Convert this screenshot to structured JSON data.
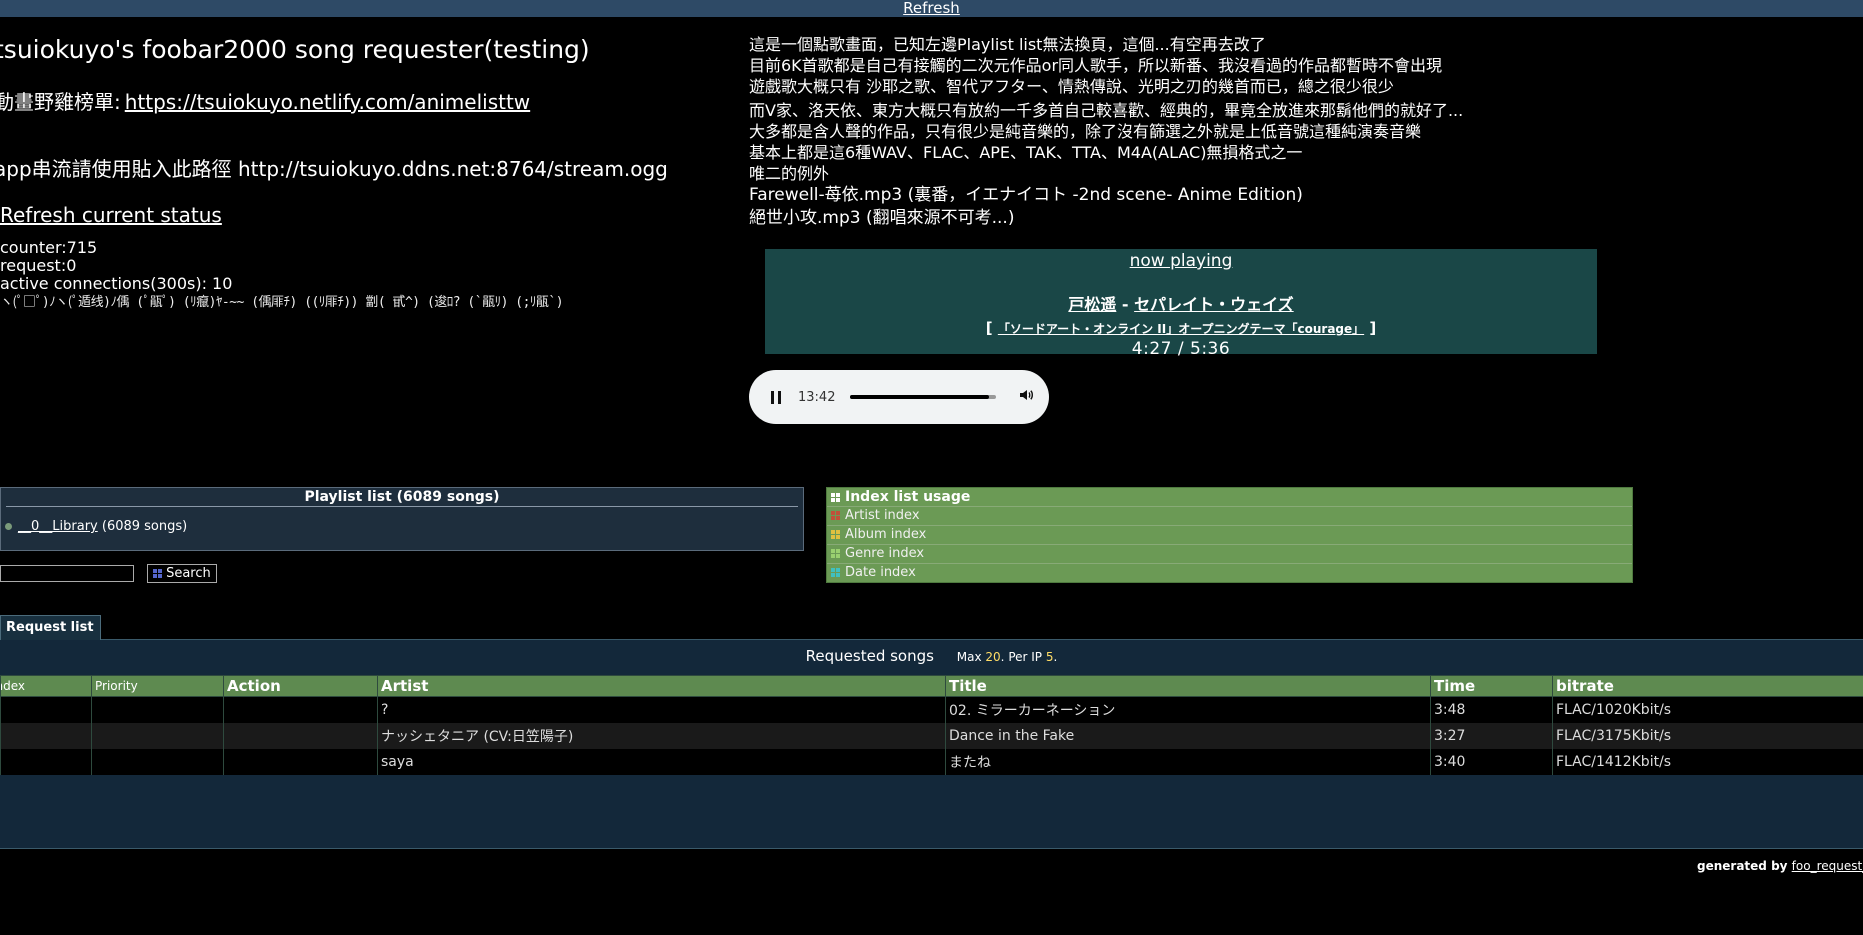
{
  "topbar": {
    "refresh_label": "Refresh"
  },
  "header": {
    "title": "tsuiokuyo's foobar2000 song requester(testing)",
    "rank_label": "動畫野雞榜單:",
    "rank_link": "https://tsuiokuyo.netlify.com/animelisttw",
    "stream_text": "app串流請使用貼入此路徑 http://tsuiokuyo.ddns.net:8764/stream.ogg",
    "refresh_status": "Refresh current status"
  },
  "stats": {
    "counter": "counter:715",
    "request": "request:0",
    "active": "active connections(300s): 10",
    "garbled": "ヽ(ﾟ□ﾟ)ﾉヽ(ﾟ遁线)ﾉ偊 (ﾟ瓹ﾟ) (ﾘ癙)ﾔ-~~ (偊厞ﾁ) ((ﾘ厞ﾁ)) 劏( 甙^) (逡ﾛ? (`瓹ﾘ) (;ﾘ瓹`)"
  },
  "notice": {
    "lines": [
      "這是一個點歌畫面，已知左邊Playlist list無法換頁，這個...有空再去改了",
      "目前6K首歌都是自己有接觸的二次元作品or同人歌手，所以新番、我沒看過的作品都暫時不會出現",
      "遊戲歌大概只有 沙耶之歌、智代アフター、情熱傳說、光明之刃的幾首而已，總之很少很少",
      "而V家、洛天依、東方大概只有放約一千多首自己較喜歡、經典的，畢竟全放進來那鬍他們的就好了...",
      "大多都是含人聲的作品，只有很少是純音樂的，除了沒有篩選之外就是上低音號這種純演奏音樂",
      "基本上都是這6種WAV、FLAC、APE、TAK、TTA、M4A(ALAC)無損格式之一",
      "唯二的例外",
      "Farewell-苺依.mp3 (裏番，イエナイコト -2nd scene- Anime Edition)",
      "絕世小攻.mp3 (翻唱來源不可考...)"
    ]
  },
  "now_playing": {
    "heading": "now playing",
    "artist": "戸松遥",
    "separator": " - ",
    "title": "セパレイト・ウェイズ",
    "album_open": "[ ",
    "album": "「ソードアート・オンライン II」オープニングテーマ「courage」",
    "album_close": " ]",
    "time": "4:27 / 5:36"
  },
  "player": {
    "time": "13:42",
    "progress": 0.95
  },
  "playlist": {
    "heading": "Playlist list (6089 songs)",
    "item_link": "__0__Library",
    "item_count": "(6089 songs)"
  },
  "search": {
    "button_label": "Search",
    "value": ""
  },
  "index": {
    "heading": "Index list usage",
    "items": [
      {
        "label": "Artist index",
        "color": "#c0503a"
      },
      {
        "label": "Album index",
        "color": "#e0c040"
      },
      {
        "label": "Genre index",
        "color": "#9ad070"
      },
      {
        "label": "Date index",
        "color": "#40c0c0"
      }
    ],
    "head_color": "#ffffff"
  },
  "request_tab": {
    "label": "Request list"
  },
  "requested": {
    "heading": "Requested songs",
    "max_label": "Max",
    "max_value": "20",
    "per_ip_label": "Per IP",
    "per_ip_value": "5",
    "period": "."
  },
  "table": {
    "headers": [
      "Index",
      "Priority",
      "Action",
      "Artist",
      "Title",
      "Time",
      "bitrate"
    ],
    "rows": [
      [
        "",
        "",
        "",
        "?",
        "02. ミラーカーネーション",
        "3:48",
        "FLAC/1020Kbit/s"
      ],
      [
        "",
        "",
        "",
        "ナッシェタニア (CV:日笠陽子)",
        "Dance in the Fake",
        "3:27",
        "FLAC/3175Kbit/s"
      ],
      [
        "",
        "",
        "",
        "saya",
        "またね",
        "3:40",
        "FLAC/1412Kbit/s"
      ]
    ]
  },
  "footer": {
    "generated_by": "generated by",
    "link": "foo_request_base"
  }
}
